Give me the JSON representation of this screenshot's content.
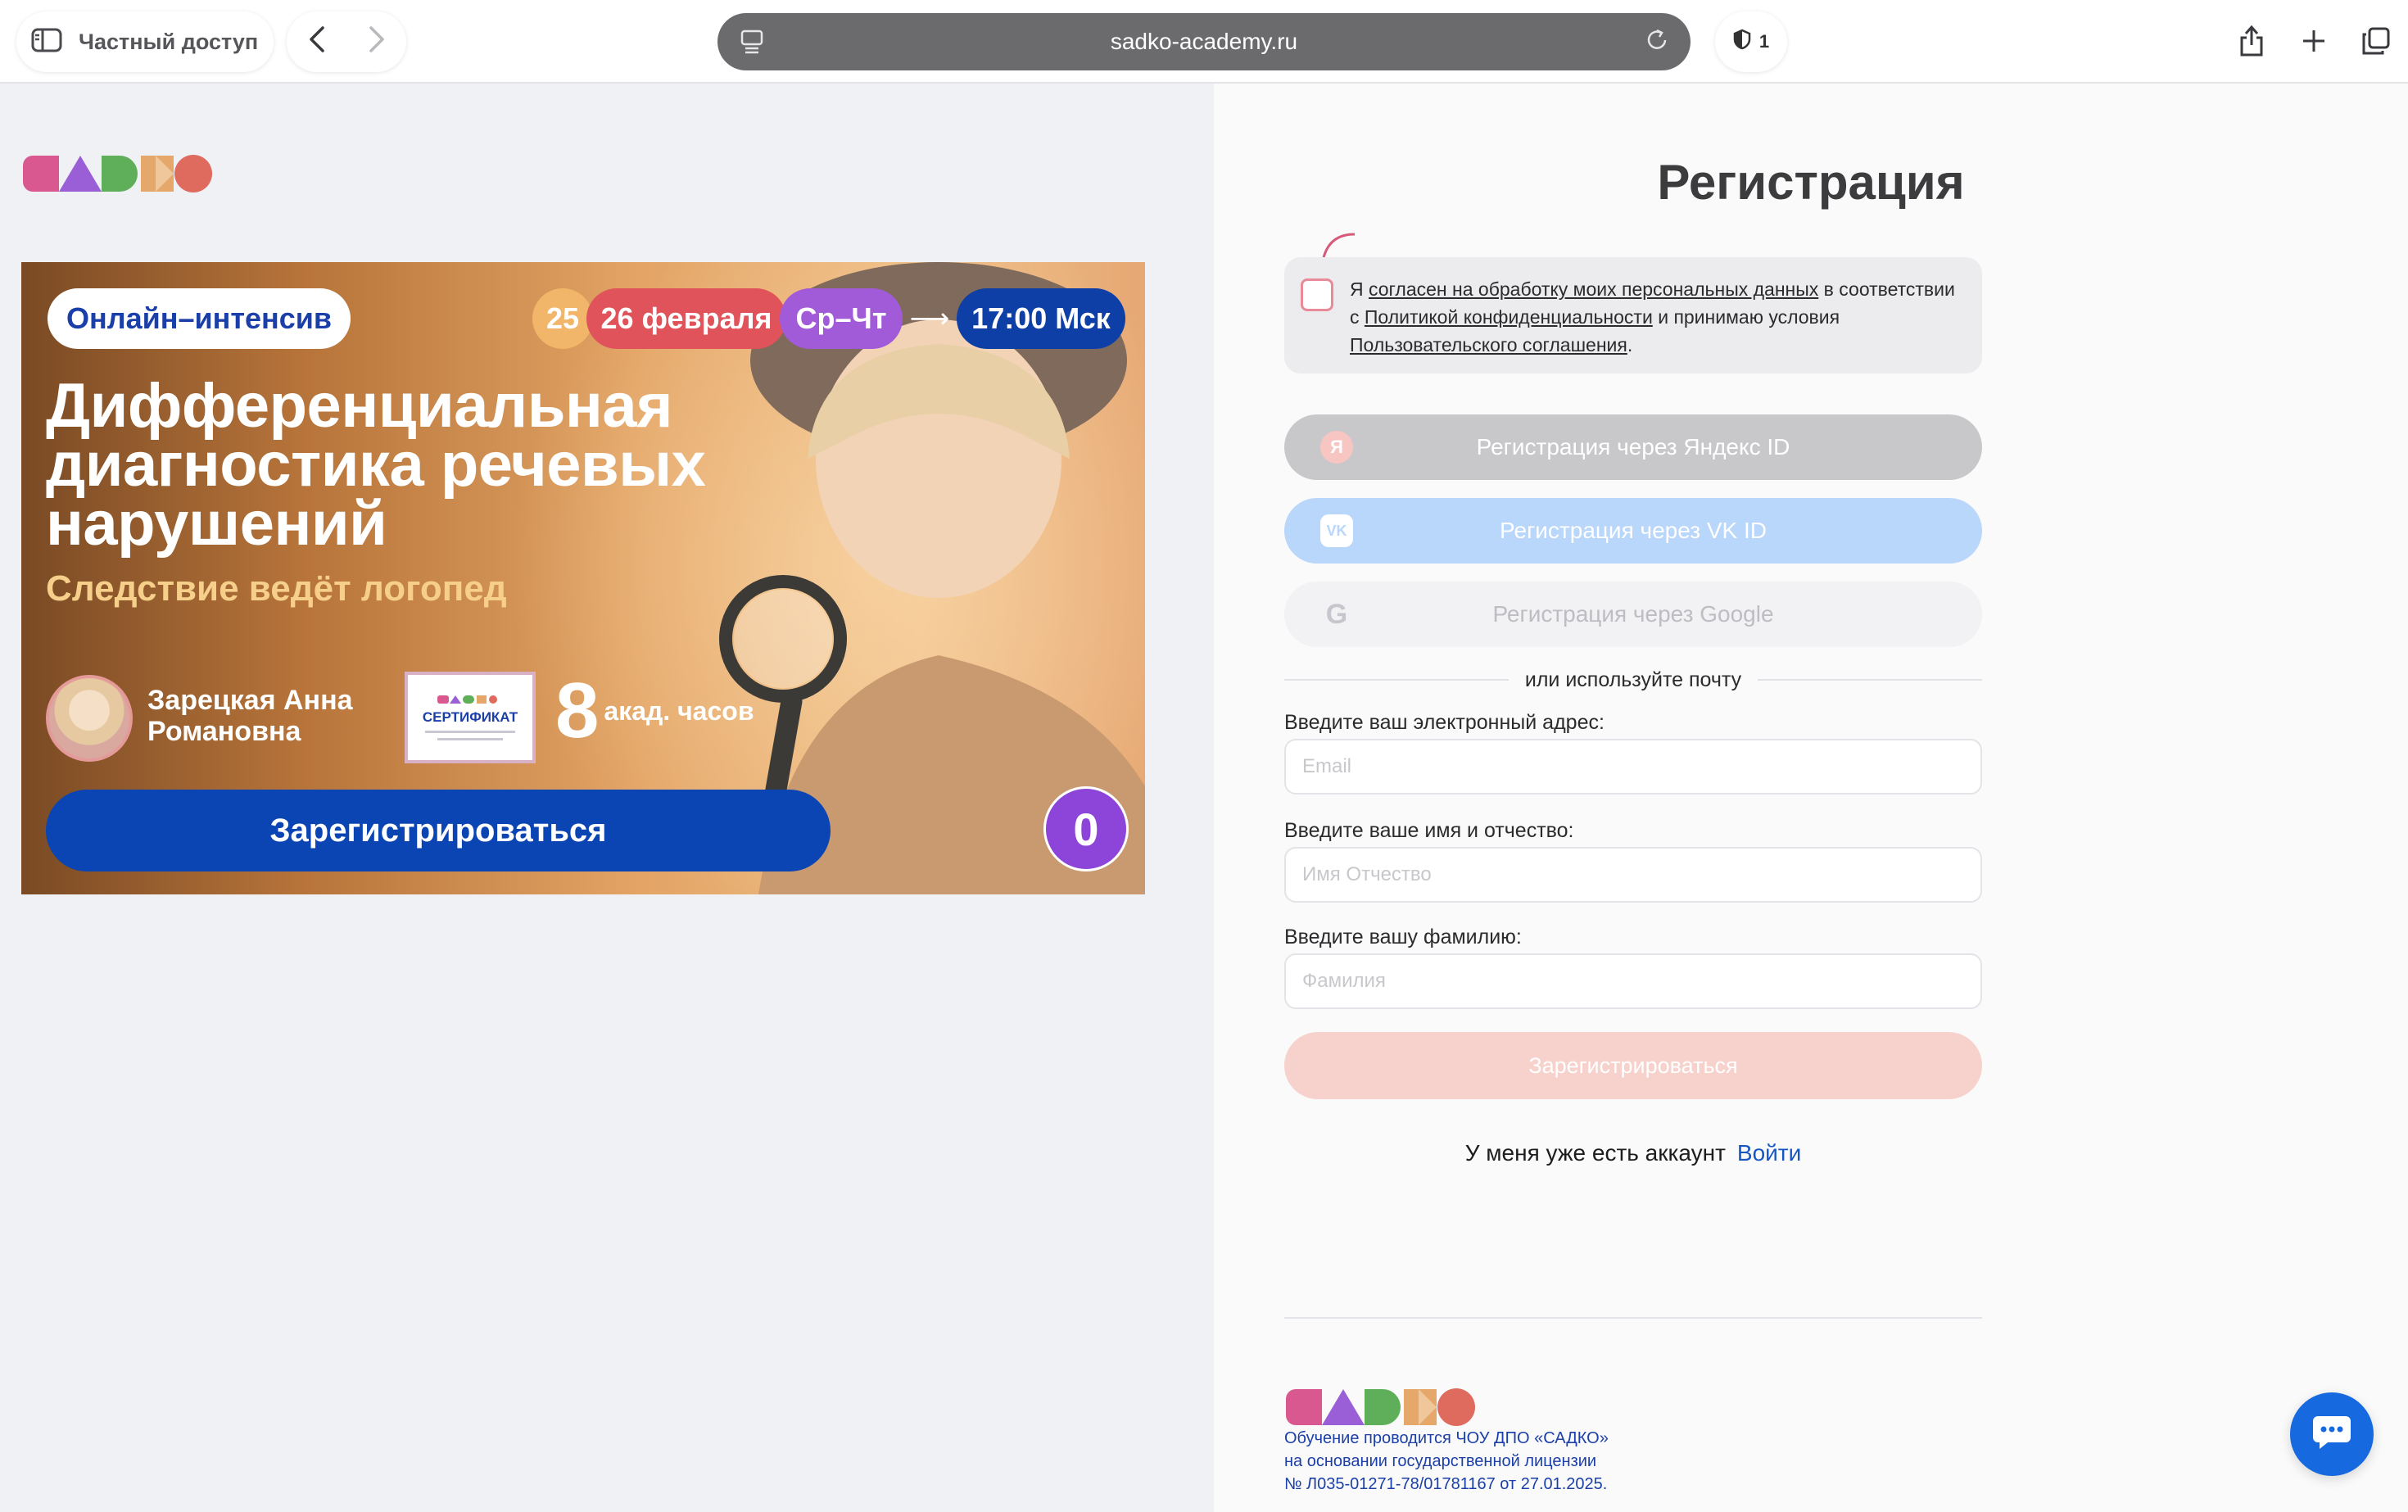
{
  "browser": {
    "private_label": "Частный доступ",
    "url": "sadko-academy.ru",
    "tracker_count": "1"
  },
  "banner": {
    "tag": "Онлайн–интенсив",
    "day1": "25",
    "dates": "26 февраля",
    "weekdays": "Ср–Чт",
    "arrow": "⟶",
    "time": "17:00 Мск",
    "headline": "Дифференциальная диагностика речевых нарушений",
    "subtitle": "Следствие ведёт логопед",
    "speaker": "Зарецкая Анна Романовна",
    "certificate": "СЕРТИФИКАТ",
    "hours_number": "8",
    "hours_text": "акад. часов",
    "cta": "Зарегистрироваться",
    "free_number": "0"
  },
  "form": {
    "title": "Регистрация",
    "consent": {
      "part1": "Я ",
      "link1": "согласен на обработку моих персональных данных",
      "part2": " в соответствии с ",
      "link2": "Политикой конфиденциальности",
      "part3": " и принимаю условия ",
      "link3": "Пользовательского соглашения",
      "part4": "."
    },
    "yandex_label": "Регистрация через Яндекс ID",
    "yandex_icon": "Я",
    "vk_label": "Регистрация через VK ID",
    "vk_icon": "VK",
    "google_label": "Регистрация через Google",
    "google_icon": "G",
    "or_text": "или используйте почту",
    "email_label": "Введите ваш электронный адрес:",
    "email_placeholder": "Email",
    "name_label": "Введите ваше имя и отчество:",
    "name_placeholder": "Имя Отчество",
    "surname_label": "Введите вашу фамилию:",
    "surname_placeholder": "Фамилия",
    "submit_label": "Зарегистрироваться",
    "have_account": "У меня уже есть аккаунт",
    "login_link": "Войти"
  },
  "footer": {
    "line1": "Обучение проводится ЧОУ ДПО «САДКО»",
    "line2": "на основании государственной лицензии",
    "line3": "№ Л035-01271-78/01781167 от 27.01.2025."
  },
  "colors": {
    "brand_blue": "#0a45b3",
    "logo_pink": "#d9588f",
    "logo_purple": "#9a5fd6",
    "logo_green": "#5fae5a",
    "logo_orange": "#e6a86a",
    "logo_red": "#df6a5e",
    "date_red": "#e0535a",
    "weekday_purple": "#a25bd8",
    "time_blue": "#0d3fa6"
  },
  "icons": [
    "sidebar-icon",
    "chevron-left-icon",
    "chevron-right-icon",
    "page-menu-icon",
    "reload-icon",
    "shield-icon",
    "share-icon",
    "plus-icon",
    "tabs-icon",
    "chat-icon"
  ]
}
